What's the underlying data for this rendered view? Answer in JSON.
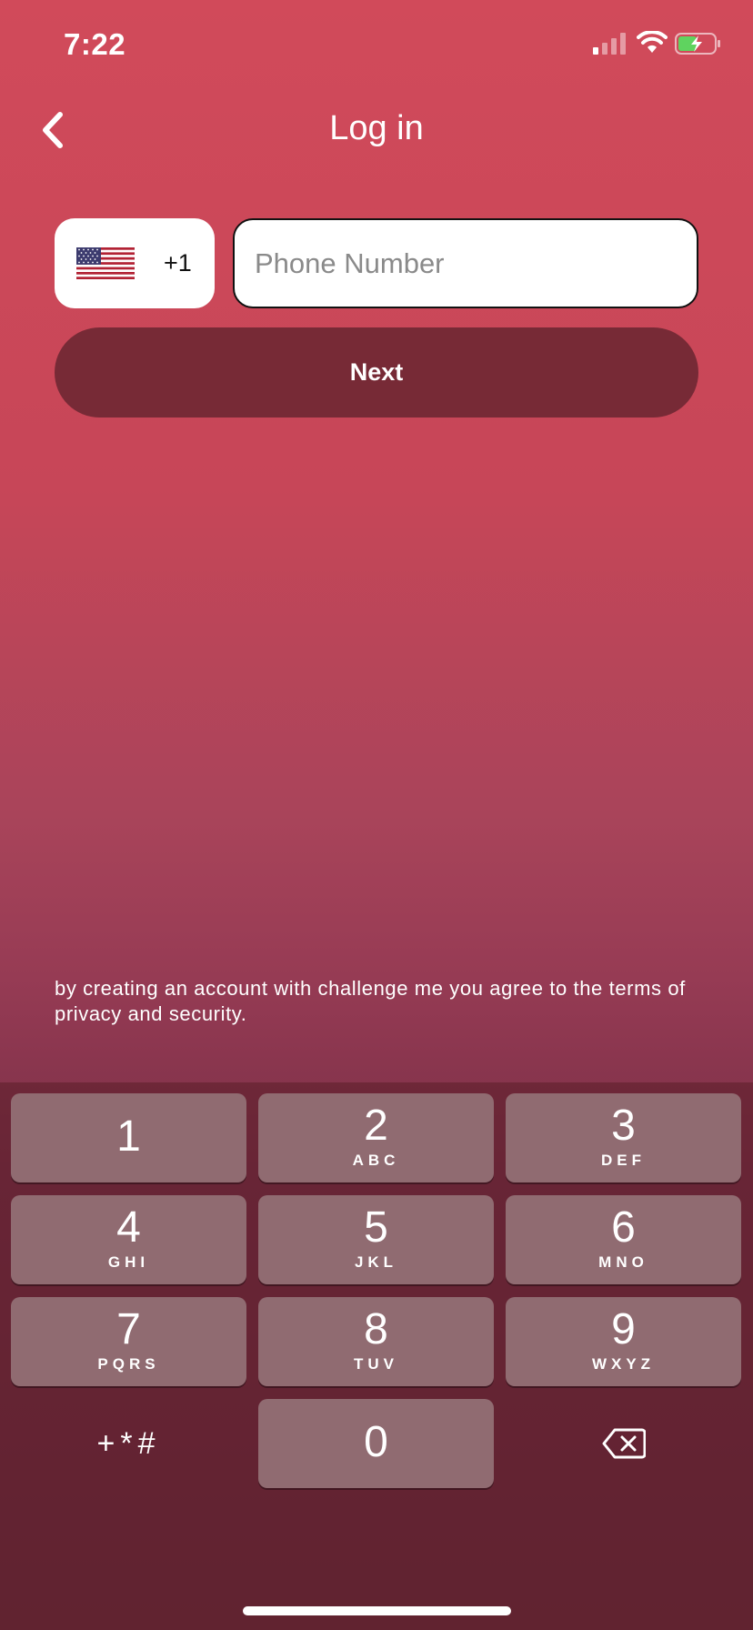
{
  "status_bar": {
    "time": "7:22",
    "icons": [
      "signal-icon",
      "wifi-icon",
      "battery-charging-icon"
    ]
  },
  "header": {
    "title": "Log in",
    "back_icon": "chevron-left-icon"
  },
  "form": {
    "country_flag": "us-flag-icon",
    "dial_code": "+1",
    "phone_placeholder": "Phone Number",
    "phone_value": "",
    "next_label": "Next"
  },
  "terms_text": "by creating an account with challenge me you agree to the terms of privacy and security.",
  "keypad": {
    "keys": [
      {
        "num": "1",
        "letters": ""
      },
      {
        "num": "2",
        "letters": "ABC"
      },
      {
        "num": "3",
        "letters": "DEF"
      },
      {
        "num": "4",
        "letters": "GHI"
      },
      {
        "num": "5",
        "letters": "JKL"
      },
      {
        "num": "6",
        "letters": "MNO"
      },
      {
        "num": "7",
        "letters": "PQRS"
      },
      {
        "num": "8",
        "letters": "TUV"
      },
      {
        "num": "9",
        "letters": "WXYZ"
      },
      {
        "num": "0",
        "letters": ""
      }
    ],
    "symbols_label": "+*#",
    "delete_icon": "backspace-icon"
  },
  "colors": {
    "background_top": "#d14a5a",
    "background_bottom": "#6a2a3b",
    "next_button": "#772a36",
    "key_background": "#906b71"
  }
}
